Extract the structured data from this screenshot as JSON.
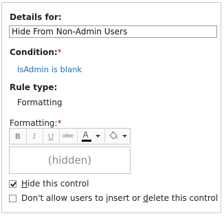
{
  "details": {
    "label": "Details for:",
    "value": "Hide From Non-Admin Users"
  },
  "condition": {
    "label": "Condition:",
    "required_mark": "*",
    "link_text": "IsAdmin is blank"
  },
  "rule_type": {
    "label": "Rule type:",
    "value": "Formatting"
  },
  "formatting": {
    "label": "Formatting:",
    "required_mark": "*",
    "toolbar": {
      "bold": "B",
      "italic": "I",
      "underline": "U",
      "strikethrough": "abc",
      "font_color": "A",
      "font_color_bar": "#000000",
      "fill_icon": "paint-bucket-icon"
    },
    "preview_text": "(hidden)"
  },
  "options": {
    "hide_control": {
      "pre": "",
      "accel": "H",
      "post": "ide this control",
      "checked": true
    },
    "disallow_insert_delete": {
      "pre": "Don't allow users to ",
      "accel1": "i",
      "mid": "nsert or ",
      "accel2": "d",
      "post": "elete this control",
      "checked": false
    }
  },
  "colors": {
    "link": "#1c6db5",
    "required": "#cc0000",
    "border": "#c7c7c7"
  }
}
